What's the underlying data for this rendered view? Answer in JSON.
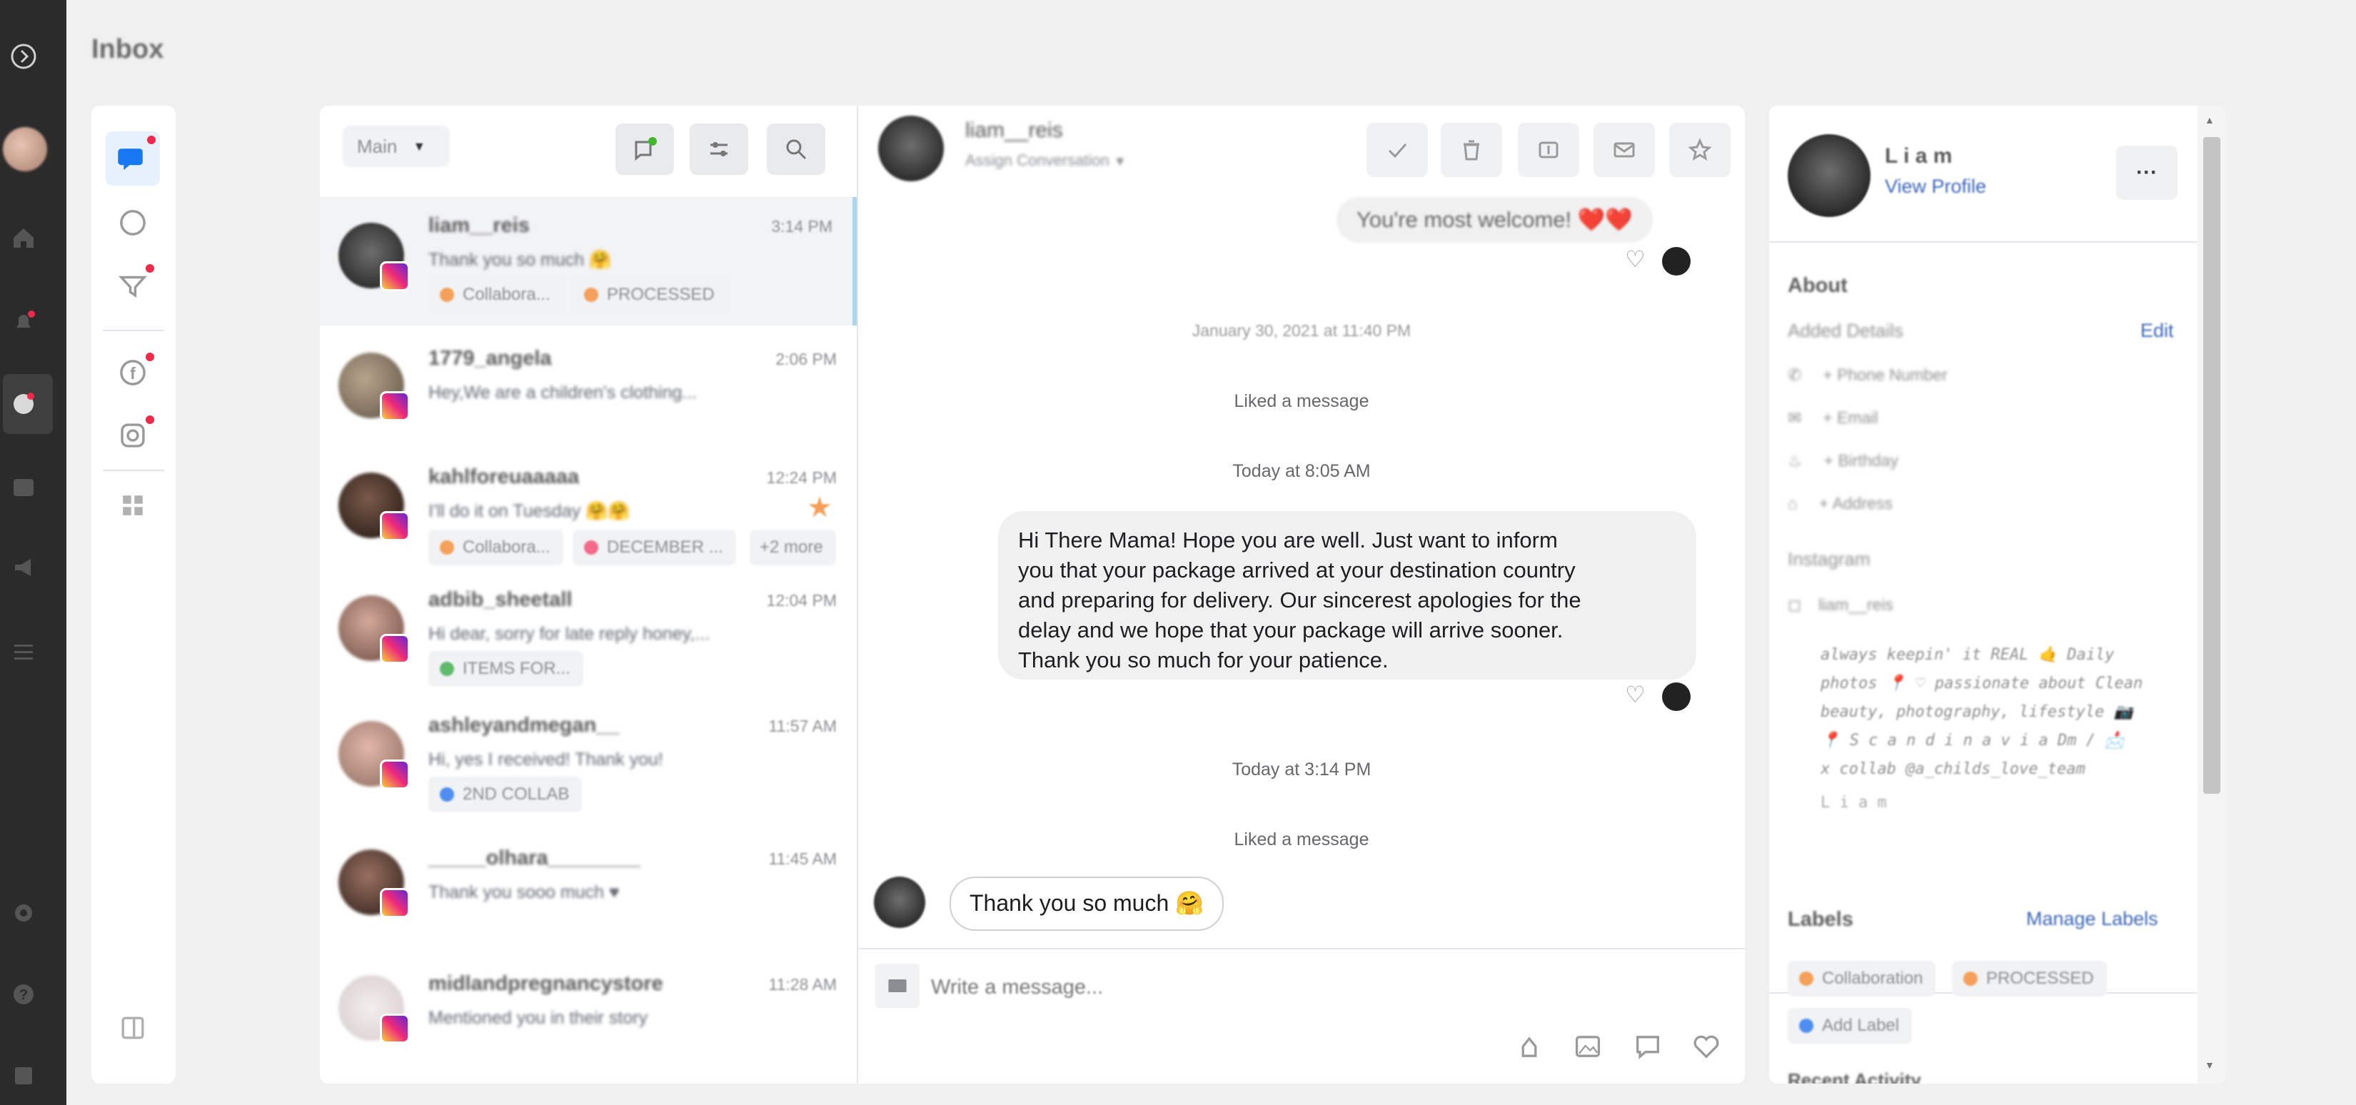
{
  "page": {
    "title": "Inbox"
  },
  "colors": {
    "accent_blue": "#1877f2",
    "notification_red": "#f02849",
    "leftbar_bg": "#2b2b2b",
    "orange_label": "#f5a05a",
    "pink_label": "#f26b8a",
    "green_label": "#5fba6d"
  },
  "thread_list": {
    "filter_select": "Main",
    "threads": [
      {
        "name": "liam__reis",
        "preview": "Thank you so much 🤗",
        "time": "3:14 PM",
        "labels": [
          "Collabora...",
          "PROCESSED"
        ]
      },
      {
        "name": "1779_angela",
        "preview": "Hey,We are a children's clothing...",
        "time": "2:06 PM",
        "labels": []
      },
      {
        "name": "kahlforeuaaaaa",
        "preview": "I'll do it on Tuesday 🤗🤗",
        "time": "12:24 PM",
        "labels": [
          "Collabora...",
          "DECEMBER ...",
          "+2 more"
        ]
      },
      {
        "name": "adbib_sheetall",
        "preview": "Hi dear, sorry for late reply honey,...",
        "time": "12:04 PM",
        "labels": [
          "ITEMS FOR..."
        ]
      },
      {
        "name": "ashleyandmegan__",
        "preview": "Hi, yes I received! Thank you!",
        "time": "11:57 AM",
        "labels": [
          "2ND COLLAB"
        ]
      },
      {
        "name": "_____olhara________",
        "preview": "Thank you sooo much ♥",
        "time": "11:45 AM",
        "labels": []
      },
      {
        "name": "midlandpregnancystore",
        "preview": "Mentioned you in their story",
        "time": "11:28 AM",
        "labels": []
      }
    ]
  },
  "conversation": {
    "header": {
      "name": "liam__reis",
      "assignee": "Assign Conversation"
    },
    "messages": {
      "welcome": "You're most welcome! ❤️❤️",
      "date1": "January 30, 2021 at 11:40 PM",
      "liked1": "Liked a message",
      "date2": "Today at 8:05 AM",
      "long_message": [
        "Hi There Mama! Hope you are well. Just want to inform",
        "you that your package arrived at your destination country",
        "and preparing for delivery. Our sincerest apologies for the",
        "delay and we hope that your package will arrive sooner.",
        "Thank you so much for your patience."
      ],
      "date3": "Today at 3:14 PM",
      "liked2": "Liked a message",
      "reply": "Thank you so much 🤗"
    },
    "composer": {
      "placeholder": "Write a message..."
    }
  },
  "profile": {
    "name": "L i a m",
    "view_profile": "View Profile",
    "about": "About",
    "added_details": "Added Details",
    "edit": "Edit",
    "phone": "+ Phone Number",
    "email": "+ Email",
    "birthday": "+ Birthday",
    "address": "+ Address",
    "instagram_label": "Instagram",
    "instagram_handle": "liam__reis",
    "bio": [
      "always keepin' it REAL 🤙 Daily",
      "photos 📍 ♡ passionate about Clean",
      "beauty, photography, lifestyle 📷",
      "📍 S c a n d i n a v i a  Dm / 📩",
      "x collab @a_childs_love_team"
    ],
    "bio_name": "L i a m",
    "labels_title": "Labels",
    "manage_labels": "Manage Labels",
    "labels": [
      "Collaboration",
      "PROCESSED"
    ],
    "add_label": "Add Label",
    "cut_title": "Recent Activity"
  }
}
